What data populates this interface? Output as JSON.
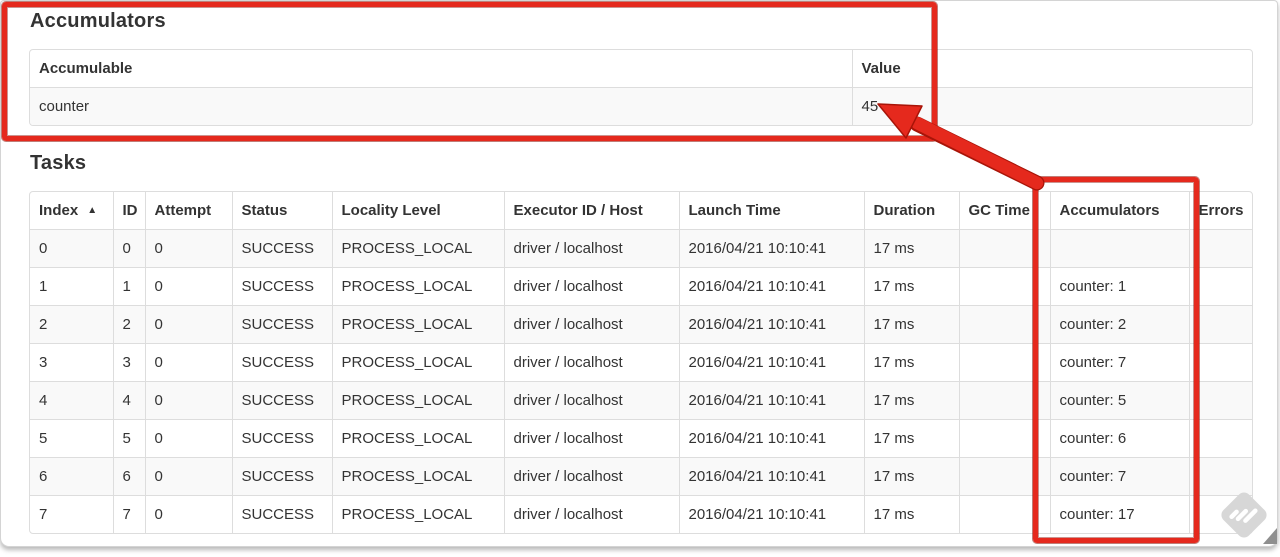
{
  "accumulators": {
    "title": "Accumulators",
    "headers": [
      "Accumulable",
      "Value"
    ],
    "rows": [
      [
        "counter",
        "45"
      ]
    ]
  },
  "tasks": {
    "title": "Tasks",
    "sort_icon": "▲",
    "headers": [
      "Index",
      "ID",
      "Attempt",
      "Status",
      "Locality Level",
      "Executor ID / Host",
      "Launch Time",
      "Duration",
      "GC Time",
      "Accumulators",
      "Errors"
    ],
    "rows": [
      [
        "0",
        "0",
        "0",
        "SUCCESS",
        "PROCESS_LOCAL",
        "driver / localhost",
        "2016/04/21 10:10:41",
        "17 ms",
        "",
        "",
        ""
      ],
      [
        "1",
        "1",
        "0",
        "SUCCESS",
        "PROCESS_LOCAL",
        "driver / localhost",
        "2016/04/21 10:10:41",
        "17 ms",
        "",
        "counter: 1",
        ""
      ],
      [
        "2",
        "2",
        "0",
        "SUCCESS",
        "PROCESS_LOCAL",
        "driver / localhost",
        "2016/04/21 10:10:41",
        "17 ms",
        "",
        "counter: 2",
        ""
      ],
      [
        "3",
        "3",
        "0",
        "SUCCESS",
        "PROCESS_LOCAL",
        "driver / localhost",
        "2016/04/21 10:10:41",
        "17 ms",
        "",
        "counter: 7",
        ""
      ],
      [
        "4",
        "4",
        "0",
        "SUCCESS",
        "PROCESS_LOCAL",
        "driver / localhost",
        "2016/04/21 10:10:41",
        "17 ms",
        "",
        "counter: 5",
        ""
      ],
      [
        "5",
        "5",
        "0",
        "SUCCESS",
        "PROCESS_LOCAL",
        "driver / localhost",
        "2016/04/21 10:10:41",
        "17 ms",
        "",
        "counter: 6",
        ""
      ],
      [
        "6",
        "6",
        "0",
        "SUCCESS",
        "PROCESS_LOCAL",
        "driver / localhost",
        "2016/04/21 10:10:41",
        "17 ms",
        "",
        "counter: 7",
        ""
      ],
      [
        "7",
        "7",
        "0",
        "SUCCESS",
        "PROCESS_LOCAL",
        "driver / localhost",
        "2016/04/21 10:10:41",
        "17 ms",
        "",
        "counter: 17",
        ""
      ]
    ]
  },
  "annotation": {
    "color": "#e5291d"
  }
}
